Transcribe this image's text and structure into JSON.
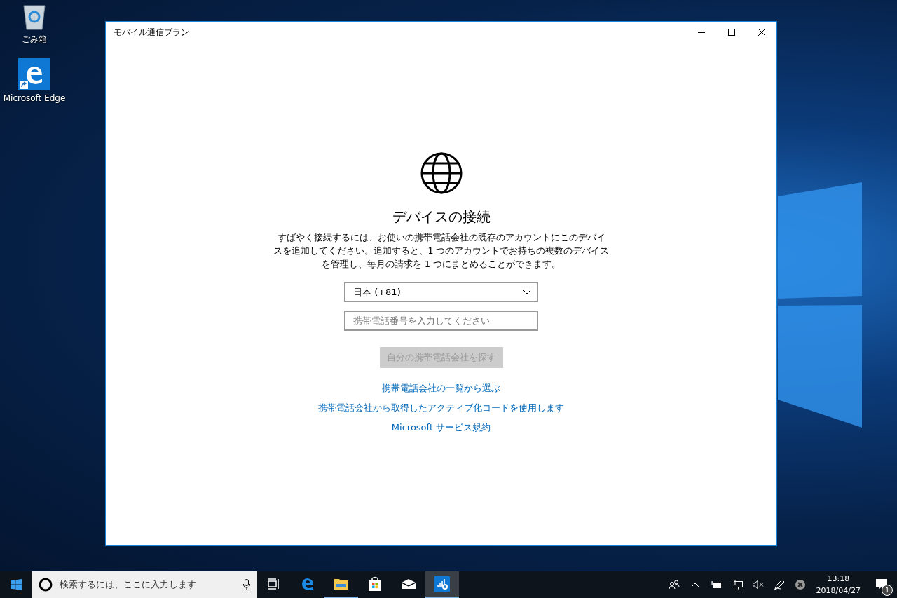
{
  "desktop_icons": [
    {
      "kind": "recycle-bin",
      "label": "ごみ箱"
    },
    {
      "kind": "edge-shortcut",
      "label": "Microsoft Edge"
    }
  ],
  "window": {
    "title": "モバイル通信プラン",
    "heading": "デバイスの接続",
    "description": "すばやく接続するには、お使いの携帯電話会社の既存のアカウントにこのデバイスを追加してください。追加すると、1 つのアカウントでお持ちの複数のデバイスを管理し、毎月の請求を 1 つにまとめることができます。",
    "country_select": {
      "value": "日本 (+81)"
    },
    "phone_field": {
      "placeholder": "携帯電話番号を入力してください"
    },
    "find_button": {
      "label": "自分の携帯電話会社を探す",
      "disabled": true
    },
    "links": [
      "携帯電話会社の一覧から選ぶ",
      "携帯電話会社から取得したアクティブ化コードを使用します",
      "Microsoft サービス規約"
    ]
  },
  "taskbar": {
    "search": {
      "placeholder": "検索するには、ここに入力します"
    },
    "apps": [
      {
        "kind": "task-view",
        "running": false,
        "selected": false
      },
      {
        "kind": "edge",
        "running": false,
        "selected": false
      },
      {
        "kind": "explorer",
        "running": true,
        "selected": false
      },
      {
        "kind": "store",
        "running": false,
        "selected": false
      },
      {
        "kind": "mail",
        "running": false,
        "selected": false
      },
      {
        "kind": "mobile-plans",
        "running": true,
        "selected": true
      }
    ],
    "time": "13:18",
    "date": "2018/04/27",
    "notification_count": "1"
  }
}
